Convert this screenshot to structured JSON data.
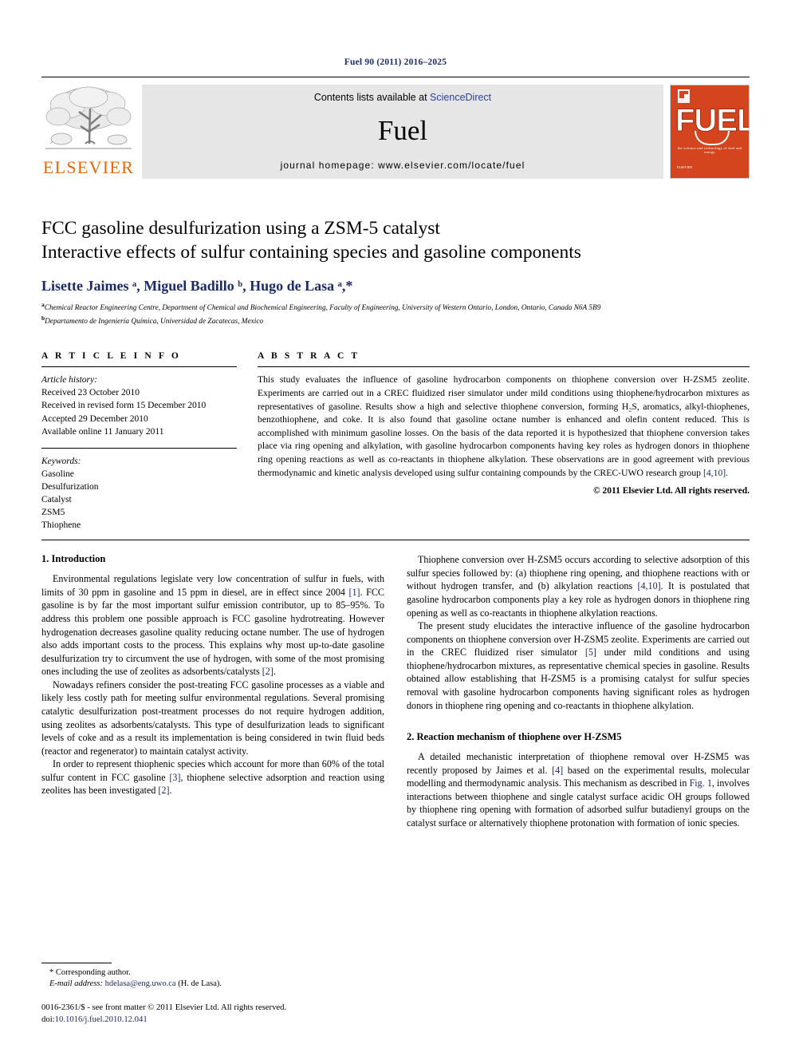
{
  "running_head": "Fuel 90 (2011) 2016–2025",
  "masthead": {
    "elsevier_wordmark": "ELSEVIER",
    "contents_prefix": "Contents lists available at ",
    "sciencedirect": "ScienceDirect",
    "journal_name": "Fuel",
    "homepage": "journal homepage: www.elsevier.com/locate/fuel",
    "cover": {
      "title": "FUEL",
      "subtitle": "the science and technology of fuel and energy",
      "publisher": "ELSEVIER"
    }
  },
  "article": {
    "title_line1": "FCC gasoline desulfurization using a ZSM-5 catalyst",
    "title_line2": "Interactive effects of sulfur containing species and gasoline components",
    "authors": "Lisette Jaimes ᵃ, Miguel Badillo ᵇ, Hugo de Lasa ᵃ,*",
    "affiliation_a": "Chemical Reactor Engineering Centre, Department of Chemical and Biochemical Engineering, Faculty of Engineering, University of Western Ontario, London, Ontario, Canada N6A 5B9",
    "affiliation_b": "Departamento de Ingeniería Química, Universidad de Zacatecas, Mexico"
  },
  "article_info": {
    "heading": "A R T I C L E   I N F O",
    "history_label": "Article history:",
    "history": [
      "Received 23 October 2010",
      "Received in revised form 15 December 2010",
      "Accepted 29 December 2010",
      "Available online 11 January 2011"
    ],
    "keywords_label": "Keywords:",
    "keywords": [
      "Gasoline",
      "Desulfurization",
      "Catalyst",
      "ZSM5",
      "Thiophene"
    ]
  },
  "abstract": {
    "heading": "A B S T R A C T",
    "text": "This study evaluates the influence of gasoline hydrocarbon components on thiophene conversion over H-ZSM5 zeolite. Experiments are carried out in a CREC fluidized riser simulator under mild conditions using thiophene/hydrocarbon mixtures as representatives of gasoline. Results show a high and selective thiophene conversion, forming H₂S, aromatics, alkyl-thiophenes, benzothiophene, and coke. It is also found that gasoline octane number is enhanced and olefin content reduced. This is accomplished with minimum gasoline losses. On the basis of the data reported it is hypothesized that thiophene conversion takes place via ring opening and alkylation, with gasoline hydrocarbon components having key roles as hydrogen donors in thiophene ring opening reactions as well as co-reactants in thiophene alkylation. These observations are in good agreement with previous thermodynamic and kinetic analysis developed using sulfur containing compounds by the CREC-UWO research group ",
    "citation": "[4,10]",
    "text_tail": ".",
    "copyright": "© 2011 Elsevier Ltd. All rights reserved."
  },
  "sections": {
    "intro_heading": "1. Introduction",
    "intro_p1_a": "Environmental regulations legislate very low concentration of sulfur in fuels, with limits of 30 ppm in gasoline and 15 ppm in diesel, are in effect since 2004 ",
    "intro_p1_ref": "[1]",
    "intro_p1_b": ". FCC gasoline is by far the most important sulfur emission contributor, up to 85–95%. To address this problem one possible approach is FCC gasoline hydrotreating. However hydrogenation decreases gasoline quality reducing octane number. The use of hydrogen also adds important costs to the process. This explains why most up-to-date gasoline desulfurization try to circumvent the use of hydrogen, with some of the most promising ones including the use of zeolites as adsorbents/catalysts ",
    "intro_p1_ref2": "[2]",
    "intro_p1_c": ".",
    "intro_p2": "Nowadays refiners consider the post-treating FCC gasoline processes as a viable and likely less costly path for meeting sulfur environmental regulations. Several promising catalytic desulfurization post-treatment processes do not require hydrogen addition, using zeolites as adsorbents/catalysts. This type of desulfurization leads to significant levels of coke and as a result its implementation is being considered in twin fluid beds (reactor and regenerator) to maintain catalyst activity.",
    "intro_p3_a": "In order to represent thiophenic species which account for more than 60% of the total sulfur content in FCC gasoline ",
    "intro_p3_ref": "[3]",
    "intro_p3_b": ", thiophene selective adsorption and reaction using zeolites has been investigated ",
    "intro_p3_ref2": "[2]",
    "intro_p3_c": ".",
    "right_p1_a": "Thiophene conversion over H-ZSM5 occurs according to selective adsorption of this sulfur species followed by: (a) thiophene ring opening, and thiophene reactions with or without hydrogen transfer, and (b) alkylation reactions ",
    "right_p1_ref": "[4,10]",
    "right_p1_b": ". It is postulated that gasoline hydrocarbon components play a key role as hydrogen donors in thiophene ring opening as well as co-reactants in thiophene alkylation reactions.",
    "right_p2_a": "The present study elucidates the interactive influence of the gasoline hydrocarbon components on thiophene conversion over H-ZSM5 zeolite. Experiments are carried out in the CREC fluidized riser simulator ",
    "right_p2_ref": "[5]",
    "right_p2_b": " under mild conditions and using thiophene/hydrocarbon mixtures, as representative chemical species in gasoline. Results obtained allow establishing that H-ZSM5 is a promising catalyst for sulfur species removal with gasoline hydrocarbon components having significant roles as hydrogen donors in thiophene ring opening and co-reactants in thiophene alkylation.",
    "mech_heading": "2. Reaction mechanism of thiophene over H-ZSM5",
    "mech_p1_a": "A detailed mechanistic interpretation of thiophene removal over H-ZSM5 was recently proposed by Jaimes et al. ",
    "mech_p1_ref": "[4]",
    "mech_p1_b": " based on the experimental results, molecular modelling and thermodynamic analysis. This mechanism as described in ",
    "mech_p1_figref": "Fig. 1",
    "mech_p1_c": ", involves interactions between thiophene and single catalyst surface acidic OH groups followed by thiophene ring opening with formation of adsorbed sulfur butadienyl groups on the catalyst surface or alternatively thiophene protonation with formation of ionic species."
  },
  "footnote": {
    "corresponding": "* Corresponding author.",
    "email_label": "E-mail address:",
    "email": "hdelasa@eng.uwo.ca",
    "email_suffix": " (H. de Lasa)."
  },
  "footer": {
    "front_matter": "0016-2361/$ - see front matter © 2011 Elsevier Ltd. All rights reserved.",
    "doi_label": "doi:",
    "doi": "10.1016/j.fuel.2010.12.041"
  },
  "colors": {
    "accent_blue": "#1b2a6b",
    "link_blue": "#2a3fa0",
    "elsevier_orange": "#ec6608",
    "cover_red": "#d4451f"
  }
}
